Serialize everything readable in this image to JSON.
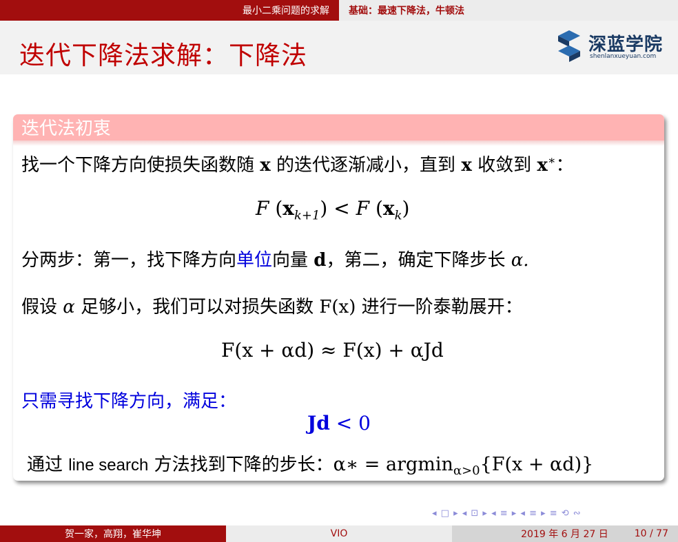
{
  "header": {
    "section_left": "最小二乘问题的求解",
    "section_right": "基础：最速下降法，牛顿法"
  },
  "slide": {
    "title": "迭代下降法求解：下降法",
    "logo_name": "深蓝学院",
    "logo_url": "shenlanxueyuan.com"
  },
  "block": {
    "heading": "迭代法初衷",
    "line1_a": "找一个下降方向使损失函数随 ",
    "line1_x": "x",
    "line1_b": " 的迭代逐渐减小，直到 ",
    "line1_x2": "x",
    "line1_c": " 收敛到 ",
    "line1_xs": "x",
    "line1_star": "∗",
    "line1_colon": "：",
    "eq1_F": "F",
    "eq1_lhs_x": "x",
    "eq1_lhs_sub": "k+1",
    "eq1_rhs_sub": "k",
    "line2_a": "分两步：第一，找下降方向",
    "line2_blue": "单位",
    "line2_b": "向量 ",
    "line2_d": "d",
    "line2_c": "，第二，确定下降步长 ",
    "line2_alpha": "α.",
    "line3_a": "假设 ",
    "line3_alpha": "α",
    "line3_b": " 足够小，我们可以对损失函数 ",
    "line3_F": "F(x)",
    "line3_c": " 进行一阶泰勒展开：",
    "eq2": "F(x + αd) ≈ F(x) + αJd",
    "line4": "只需寻找下降方向，满足：",
    "eq3_Jd": "Jd",
    "eq3_rest": " < 0",
    "line5_a": "通过 ",
    "line5_ls": "line search",
    "line5_b": " 方法找到下降的步长：",
    "line5_eq": "α∗ = argmin",
    "line5_sub": "α>0",
    "line5_tail": "{F(x + αd)}"
  },
  "nav": {
    "icons": "◂ □ ▸ ◂ ⊡ ▸ ◂ ≡ ▸ ◂ ≡ ▸   ≡   ⟲ ∾"
  },
  "footer": {
    "authors": "贺一家，高翔，崔华坤",
    "short_title": "VIO",
    "date": "2019 年 6 月 27 日",
    "page": "10 / 77"
  }
}
